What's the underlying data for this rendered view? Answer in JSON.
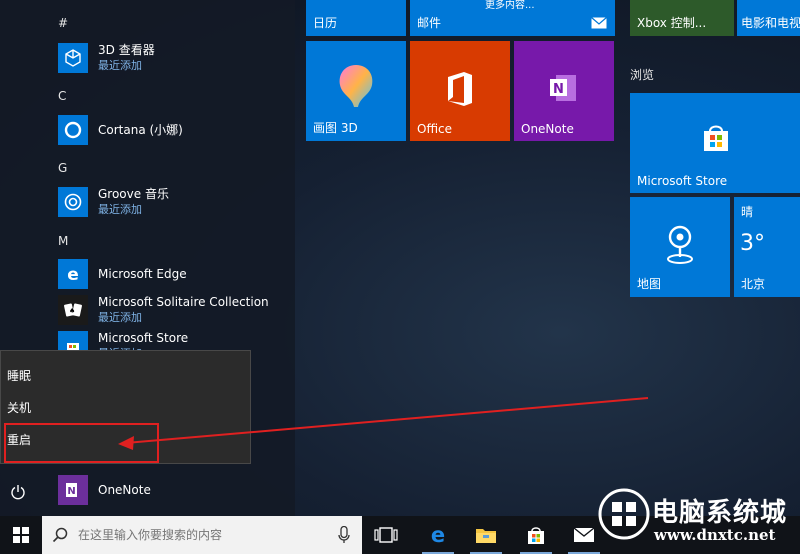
{
  "app_list": {
    "letters": {
      "hash": "#",
      "c": "C",
      "g": "G",
      "m": "M"
    },
    "apps": [
      {
        "name": "3D 查看器",
        "sub": "最近添加"
      },
      {
        "name": "Cortana (小娜)",
        "sub": ""
      },
      {
        "name": "Groove 音乐",
        "sub": "最近添加"
      },
      {
        "name": "Microsoft Edge",
        "sub": ""
      },
      {
        "name": "Microsoft Solitaire Collection",
        "sub": "最近添加"
      },
      {
        "name": "Microsoft Store",
        "sub": "最近添加"
      },
      {
        "name": "OneNote",
        "sub": ""
      }
    ]
  },
  "power_menu": {
    "sleep": "睡眠",
    "shutdown": "关机",
    "restart": "重启"
  },
  "tiles": {
    "calendar": "日历",
    "mail": "邮件",
    "mail_more": "更多内容...",
    "xbox": "Xbox 控制...",
    "movies": "电影和电视",
    "paint3d": "画图 3D",
    "office": "Office",
    "onenote": "OneNote",
    "browse_group": "浏览",
    "store": "Microsoft Store",
    "maps": "地图",
    "weather_cond": "晴",
    "weather_temp": "3°",
    "weather_city": "北京"
  },
  "taskbar": {
    "search_placeholder": "在这里输入你要搜索的内容"
  },
  "watermark": {
    "title": "电脑系统城",
    "url": "www.dnxtc.net"
  },
  "colors": {
    "accent": "#0078d7",
    "office": "#d83b01",
    "onenote": "#7719aa",
    "highlight": "#e02020"
  }
}
